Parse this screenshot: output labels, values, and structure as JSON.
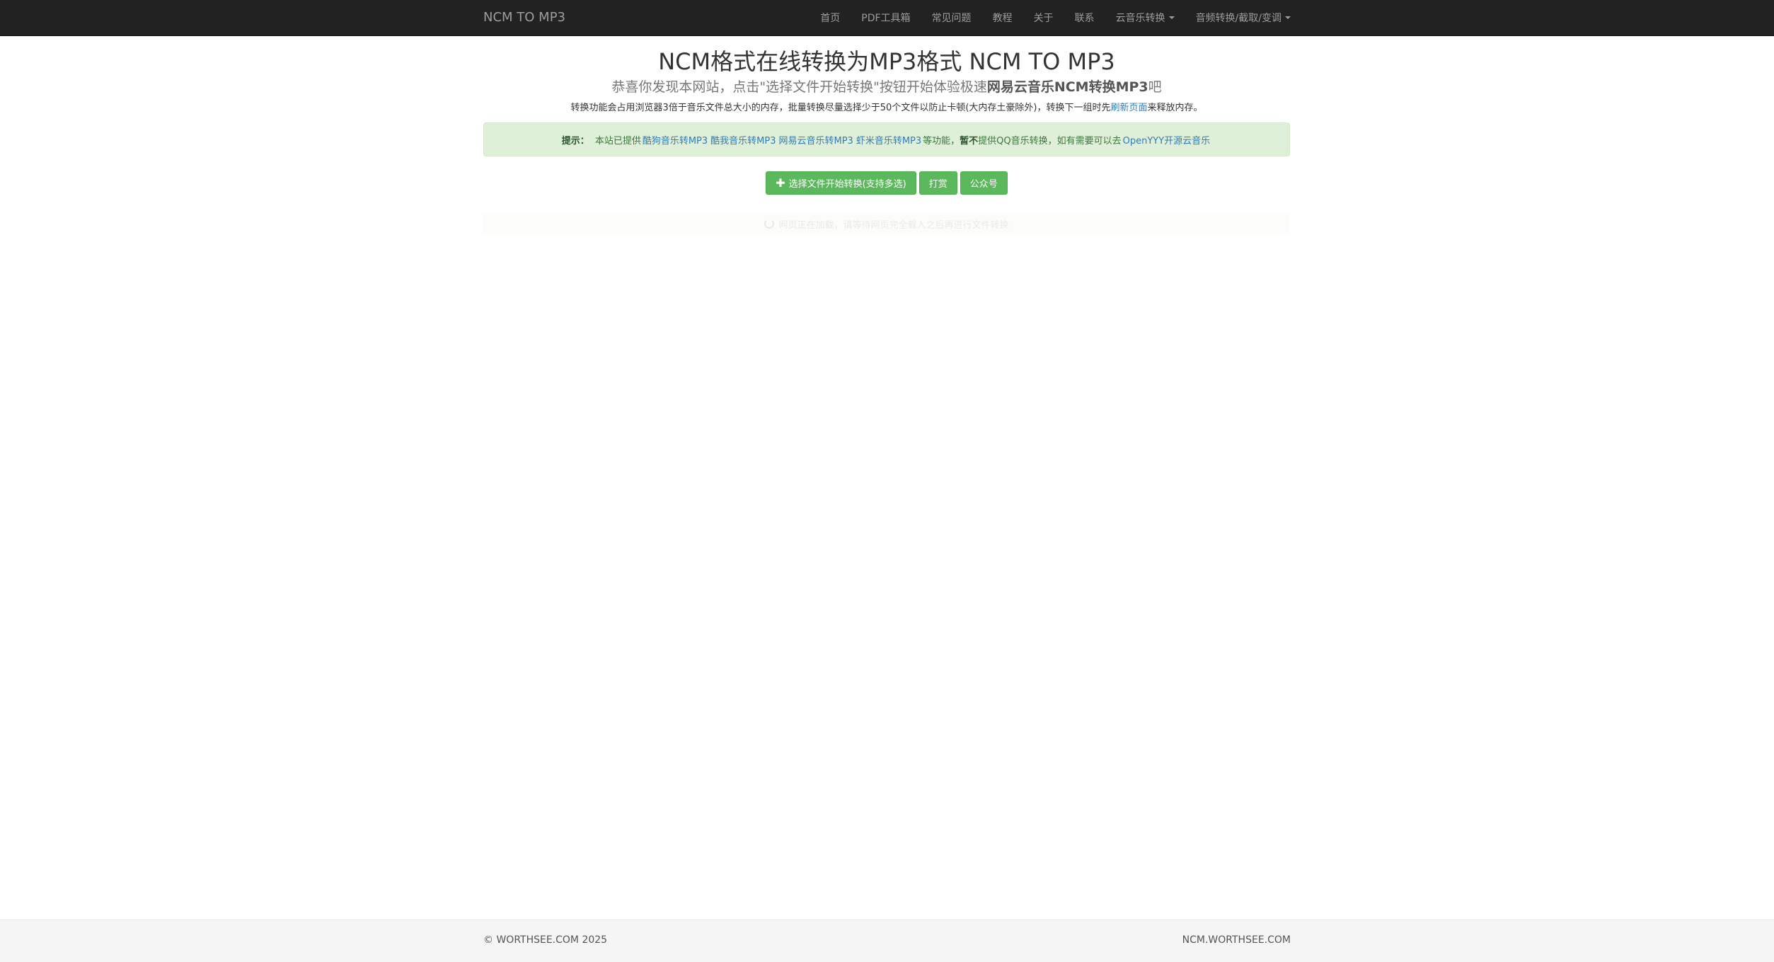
{
  "navbar": {
    "brand": "NCM TO MP3",
    "items": [
      {
        "label": "首页",
        "dropdown": false
      },
      {
        "label": "PDF工具箱",
        "dropdown": false
      },
      {
        "label": "常见问题",
        "dropdown": false
      },
      {
        "label": "教程",
        "dropdown": false
      },
      {
        "label": "关于",
        "dropdown": false
      },
      {
        "label": "联系",
        "dropdown": false
      },
      {
        "label": "云音乐转换",
        "dropdown": true
      },
      {
        "label": "音频转换/截取/变调",
        "dropdown": true
      }
    ]
  },
  "main": {
    "title": "NCM格式在线转换为MP3格式 NCM TO MP3",
    "lead": {
      "before": "恭喜你发现本网站，点击\"选择文件开始转换\"按钮开始体验极速",
      "bold": "网易云音乐NCM转换MP3",
      "after": "吧"
    },
    "note": {
      "before": "转换功能会占用浏览器3倍于音乐文件总大小的内存，批量转换尽量选择少于50个文件以防止卡顿(大内存土豪除外)，转换下一组时先",
      "link": "刷新页面",
      "after": "来释放内存。"
    },
    "alert": {
      "label": "提示：",
      "intro": "本站已提供",
      "links": [
        "酷狗音乐转MP3",
        "酷我音乐转MP3",
        "网易云音乐转MP3",
        "虾米音乐转MP3"
      ],
      "middle": "等功能，",
      "bold": "暂不",
      "after": "提供QQ音乐转换，如有需要可以去",
      "final_link": "OpenYYY开源云音乐"
    },
    "buttons": {
      "convert": "选择文件开始转换(支持多选)",
      "donate": "打赏",
      "wechat": "公众号"
    },
    "loading_text": "网页正在加载，请等待网页完全载入之后再进行文件转换"
  },
  "footer": {
    "copyright": "© WORTHSEE.COM 2025",
    "site": "NCM.WORTHSEE.COM"
  },
  "colors": {
    "navbar_bg": "#222222",
    "nav_text": "#9d9d9d",
    "success": "#5cb85c",
    "alert_bg": "#dff0d8",
    "link": "#337ab7"
  }
}
